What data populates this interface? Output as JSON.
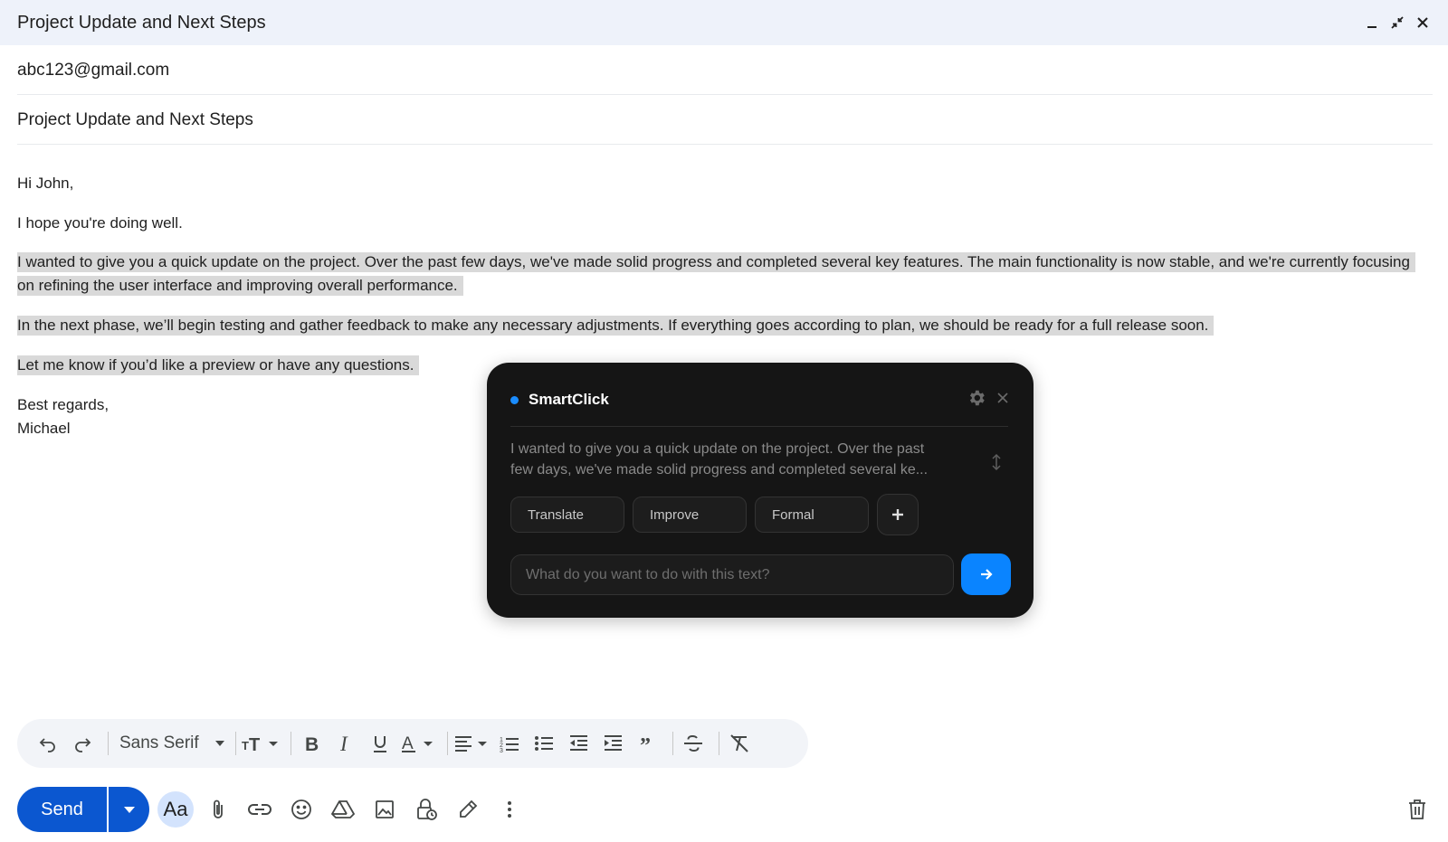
{
  "window": {
    "title": "Project Update and Next Steps",
    "controls": [
      "minimize-icon",
      "exit-fullscreen-icon",
      "close-icon"
    ]
  },
  "compose": {
    "to": "abc123@gmail.com",
    "subject": "Project Update and Next Steps",
    "body": {
      "greeting": "Hi John,",
      "line1": "I hope you're doing well.",
      "para1": "I wanted to give you a quick update on the project. Over the past few days, we've made solid progress and completed several key features. The main functionality is now stable, and we're currently focusing on refining the user interface and improving overall performance.",
      "para2": "In the next phase, we’ll begin testing and gather feedback to make any necessary adjustments. If everything goes according to plan, we should be ready for a full release soon.",
      "para3": "Let me know if you’d like a preview or have any questions.",
      "signoff": "Best regards,",
      "signature": "Michael"
    }
  },
  "smartclick": {
    "name": "SmartClick",
    "accent_color": "#1a8cff",
    "preview_line1": "I wanted to give you a quick update on the project. Over the past",
    "preview_line2": "few days, we've made solid progress and completed several ke...",
    "chips": [
      "Translate",
      "Improve",
      "Formal"
    ],
    "prompt_placeholder": "What do you want to do with this text?"
  },
  "toolbar": {
    "font": "Sans Serif"
  },
  "actions": {
    "send_label": "Send",
    "aa_label": "Aa",
    "send_color": "#0b57d0"
  }
}
